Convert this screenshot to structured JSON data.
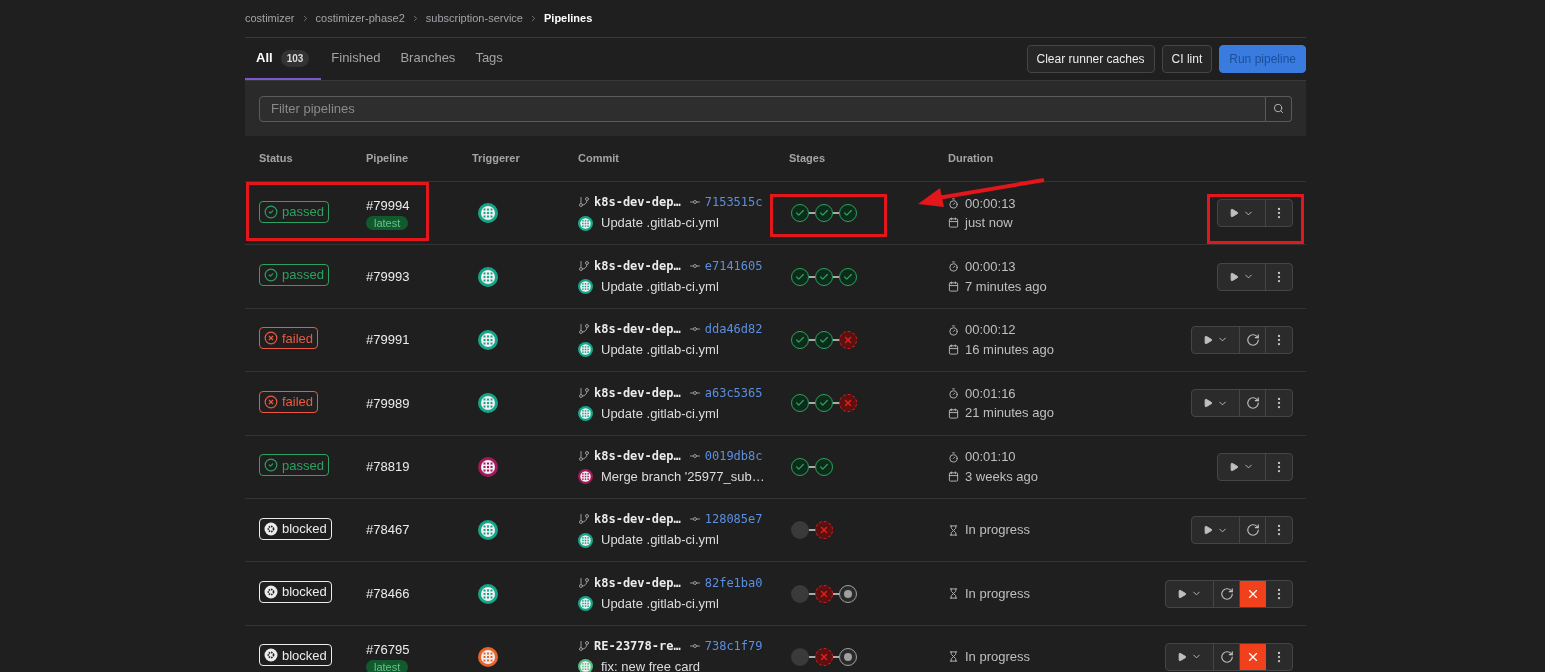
{
  "breadcrumb": [
    {
      "label": "costimizer",
      "current": false
    },
    {
      "label": "costimizer-phase2",
      "current": false
    },
    {
      "label": "subscription-service",
      "current": false
    },
    {
      "label": "Pipelines",
      "current": true
    }
  ],
  "tabs": [
    {
      "label": "All",
      "count": "103",
      "selected": true
    },
    {
      "label": "Finished",
      "selected": false
    },
    {
      "label": "Branches",
      "selected": false
    },
    {
      "label": "Tags",
      "selected": false
    }
  ],
  "buttons": [
    {
      "label": "Clear runner caches",
      "kind": "default"
    },
    {
      "label": "CI lint",
      "kind": "default"
    },
    {
      "label": "Run pipeline",
      "kind": "primary"
    }
  ],
  "filter": {
    "placeholder": "Filter pipelines"
  },
  "table": {
    "columns": [
      "Status",
      "Pipeline",
      "Triggerer",
      "Commit",
      "Stages",
      "Duration"
    ],
    "rows": [
      {
        "status": "passed",
        "pipeline": "#79994",
        "latest": "latest",
        "triggerer": {
          "color": "#17a589"
        },
        "branch": "k8s-dev-dep…",
        "sha": "7153515c",
        "author": {
          "color": "#17a589"
        },
        "message": "Update .gitlab-ci.yml",
        "stages": [
          {
            "kind": "success"
          },
          {
            "kind": "success"
          },
          {
            "kind": "success"
          }
        ],
        "duration": {
          "kind": "timed",
          "time": "00:00:13",
          "ago": "just now"
        },
        "retry": false,
        "cancel": false,
        "marked": true
      },
      {
        "status": "passed",
        "pipeline": "#79993",
        "triggerer": {
          "color": "#17a589"
        },
        "branch": "k8s-dev-dep…",
        "sha": "e7141605",
        "author": {
          "color": "#17a589"
        },
        "message": "Update .gitlab-ci.yml",
        "stages": [
          {
            "kind": "success"
          },
          {
            "kind": "success"
          },
          {
            "kind": "success"
          }
        ],
        "duration": {
          "kind": "timed",
          "time": "00:00:13",
          "ago": "7 minutes ago"
        },
        "retry": false,
        "cancel": false,
        "marked": false
      },
      {
        "status": "failed",
        "pipeline": "#79991",
        "triggerer": {
          "color": "#17a589"
        },
        "branch": "k8s-dev-dep…",
        "sha": "dda46d82",
        "author": {
          "color": "#17a589"
        },
        "message": "Update .gitlab-ci.yml",
        "stages": [
          {
            "kind": "success"
          },
          {
            "kind": "success"
          },
          {
            "kind": "failed"
          }
        ],
        "duration": {
          "kind": "timed",
          "time": "00:00:12",
          "ago": "16 minutes ago"
        },
        "retry": true,
        "cancel": false,
        "marked": false
      },
      {
        "status": "failed",
        "pipeline": "#79989",
        "triggerer": {
          "color": "#17a589"
        },
        "branch": "k8s-dev-dep…",
        "sha": "a63c5365",
        "author": {
          "color": "#17a589"
        },
        "message": "Update .gitlab-ci.yml",
        "stages": [
          {
            "kind": "success"
          },
          {
            "kind": "success"
          },
          {
            "kind": "failed"
          }
        ],
        "duration": {
          "kind": "timed",
          "time": "00:01:16",
          "ago": "21 minutes ago"
        },
        "retry": true,
        "cancel": false,
        "marked": false
      },
      {
        "status": "passed",
        "pipeline": "#78819",
        "triggerer": {
          "color": "#a3195b"
        },
        "branch": "k8s-dev-dep…",
        "sha": "0019db8c",
        "author": {
          "color": "#a3195b"
        },
        "message": "Merge branch '25977_sub…",
        "stages": [
          {
            "kind": "success"
          },
          {
            "kind": "success"
          }
        ],
        "duration": {
          "kind": "timed",
          "time": "00:01:10",
          "ago": "3 weeks ago"
        },
        "retry": false,
        "cancel": false,
        "marked": false
      },
      {
        "status": "blocked",
        "pipeline": "#78467",
        "triggerer": {
          "color": "#17a589"
        },
        "branch": "k8s-dev-dep…",
        "sha": "128085e7",
        "author": {
          "color": "#17a589"
        },
        "message": "Update .gitlab-ci.yml",
        "stages": [
          {
            "kind": "skipped"
          },
          {
            "kind": "failed"
          }
        ],
        "duration": {
          "kind": "pending",
          "text": "In progress"
        },
        "retry": true,
        "cancel": false,
        "marked": false
      },
      {
        "status": "blocked",
        "pipeline": "#78466",
        "triggerer": {
          "color": "#17a589"
        },
        "branch": "k8s-dev-dep…",
        "sha": "82fe1ba0",
        "author": {
          "color": "#17a589"
        },
        "message": "Update .gitlab-ci.yml",
        "stages": [
          {
            "kind": "skipped"
          },
          {
            "kind": "failed"
          },
          {
            "kind": "manual"
          }
        ],
        "duration": {
          "kind": "pending",
          "text": "In progress"
        },
        "retry": true,
        "cancel": true,
        "marked": false
      },
      {
        "status": "blocked",
        "pipeline": "#76795",
        "latest": "latest",
        "triggerer": {
          "color": "#e8642c"
        },
        "branch": "RE-23778-re…",
        "sha": "738c1f79",
        "author": {
          "color": "#52be80"
        },
        "message": "fix: new free card",
        "stages": [
          {
            "kind": "skipped"
          },
          {
            "kind": "failed"
          },
          {
            "kind": "manual"
          }
        ],
        "duration": {
          "kind": "pending",
          "text": "In progress"
        },
        "retry": true,
        "cancel": true,
        "marked": false
      }
    ]
  }
}
